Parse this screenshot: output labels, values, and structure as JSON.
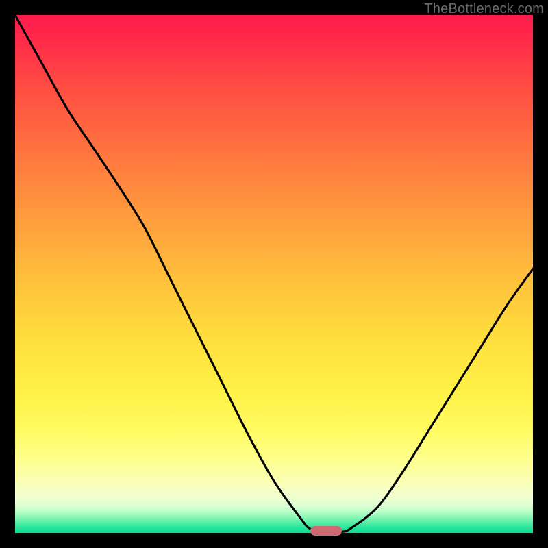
{
  "watermark": "TheBottleneck.com",
  "chart_data": {
    "type": "line",
    "title": "",
    "xlabel": "",
    "ylabel": "",
    "xlim": [
      0,
      100
    ],
    "ylim": [
      0,
      100
    ],
    "x": [
      0,
      5,
      10,
      15,
      20,
      25,
      30,
      35,
      40,
      45,
      50,
      55,
      57,
      60,
      63,
      65,
      70,
      75,
      80,
      85,
      90,
      95,
      100
    ],
    "y": [
      100,
      91,
      82,
      74.5,
      67,
      59,
      49,
      39,
      29,
      19,
      10,
      3,
      0.8,
      0.2,
      0.2,
      1.0,
      5,
      12,
      20,
      28,
      36,
      44,
      51
    ],
    "marker": {
      "x": 60,
      "y": 0.4
    },
    "background_gradient": {
      "top": "#ff1a4d",
      "mid": "#ffdd3d",
      "bottom": "#0add94"
    }
  },
  "colors": {
    "curve": "#000000",
    "frame": "#000000",
    "marker": "#cf6a73"
  }
}
